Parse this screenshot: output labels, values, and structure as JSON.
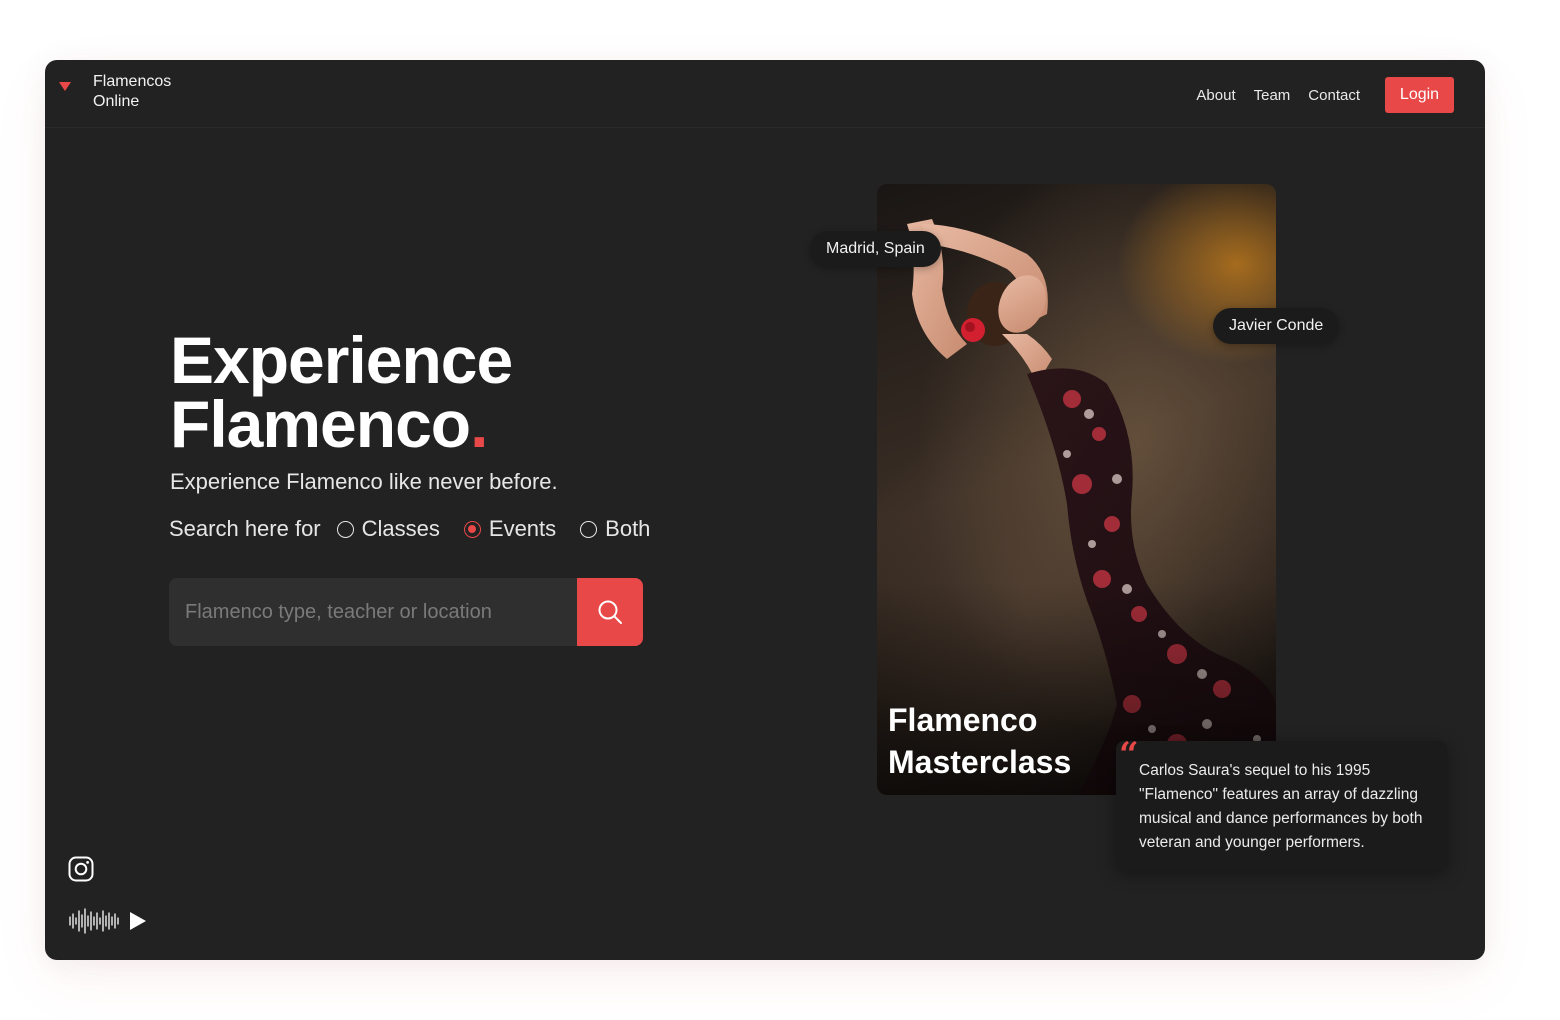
{
  "brand": {
    "name_line1": "Flamencos",
    "name_line2": "Online",
    "logo_icon": "heart-icon",
    "accent_color": "#e84848"
  },
  "nav": {
    "links": [
      "About",
      "Team",
      "Contact"
    ],
    "login_label": "Login"
  },
  "hero": {
    "title_line1": "Experience",
    "title_line2": "Flamenco",
    "title_dot": ".",
    "subtitle": "Experience Flamenco like never before."
  },
  "search": {
    "mode_label": "Search here for",
    "options": [
      "Classes",
      "Events",
      "Both"
    ],
    "selected": "Events",
    "placeholder": "Flamenco type, teacher or location",
    "value": "",
    "button_icon": "search-icon"
  },
  "feature": {
    "location_tag": "Madrid, Spain",
    "performer_tag": "Javier Conde",
    "title_line1": "Flamenco",
    "title_line2": "Masterclass",
    "quote_mark": "“",
    "quote": "Carlos Saura's sequel to his 1995 \"Flamenco\" features an array of dazzling musical and dance performances by both veteran and younger performers."
  },
  "social": {
    "icons": [
      "instagram-icon",
      "audio-wave-icon",
      "play-icon"
    ]
  },
  "colors": {
    "background": "#222222",
    "accent": "#e84848",
    "card": "#1b1b1b",
    "input": "#2f2f2f"
  }
}
